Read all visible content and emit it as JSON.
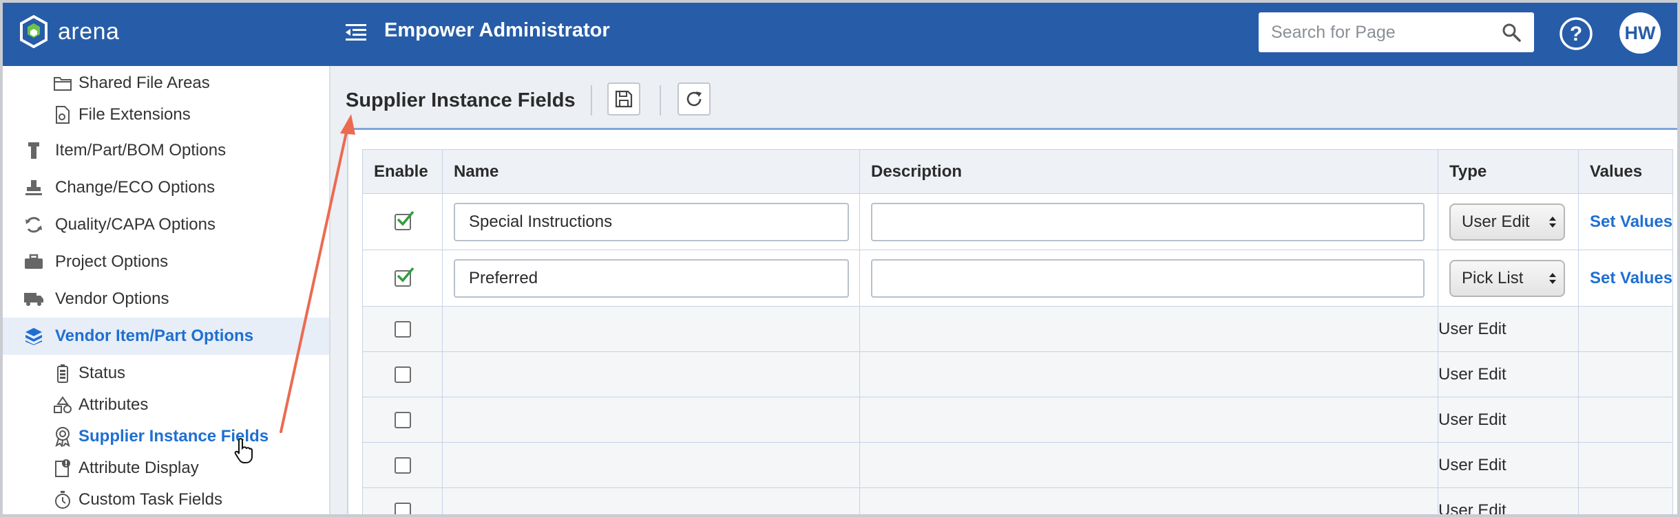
{
  "header": {
    "logo_text": "arena",
    "logo_mark": "®",
    "app_title": "Empower Administrator",
    "search_placeholder": "Search for Page",
    "avatar_initials": "HW",
    "brand_color": "#275da8"
  },
  "sidebar": {
    "items": [
      {
        "label": "Shared File Areas",
        "icon": "folder-icon",
        "level": "sub"
      },
      {
        "label": "File Extensions",
        "icon": "file-gear-icon",
        "level": "sub"
      },
      {
        "label": "Item/Part/BOM Options",
        "icon": "part-icon",
        "level": "top"
      },
      {
        "label": "Change/ECO Options",
        "icon": "stamp-icon",
        "level": "top"
      },
      {
        "label": "Quality/CAPA Options",
        "icon": "sync-icon",
        "level": "top"
      },
      {
        "label": "Project Options",
        "icon": "briefcase-icon",
        "level": "top"
      },
      {
        "label": "Vendor Options",
        "icon": "truck-icon",
        "level": "top"
      },
      {
        "label": "Vendor Item/Part Options",
        "icon": "boxes-icon",
        "level": "top",
        "active": true
      },
      {
        "label": "Status",
        "icon": "battery-icon",
        "level": "sub"
      },
      {
        "label": "Attributes",
        "icon": "shapes-icon",
        "level": "sub"
      },
      {
        "label": "Supplier Instance Fields",
        "icon": "ribbon-icon",
        "level": "sub",
        "selected": true
      },
      {
        "label": "Attribute Display",
        "icon": "doc-alert-icon",
        "level": "sub"
      },
      {
        "label": "Custom Task Fields",
        "icon": "stopwatch-icon",
        "level": "sub"
      }
    ]
  },
  "main": {
    "title": "Supplier Instance Fields",
    "columns": [
      "Enable",
      "Name",
      "Description",
      "Type",
      "Values"
    ],
    "rows": [
      {
        "enabled": true,
        "name": "Special Instructions",
        "description": "",
        "type": "User Edit",
        "type_select": true,
        "values": "Set Values"
      },
      {
        "enabled": true,
        "name": "Preferred",
        "description": "",
        "type": "Pick List",
        "type_select": true,
        "values": "Set Values"
      },
      {
        "enabled": false,
        "name": "",
        "description": "",
        "type": "User Edit",
        "type_select": false,
        "values": ""
      },
      {
        "enabled": false,
        "name": "",
        "description": "",
        "type": "User Edit",
        "type_select": false,
        "values": ""
      },
      {
        "enabled": false,
        "name": "",
        "description": "",
        "type": "User Edit",
        "type_select": false,
        "values": ""
      },
      {
        "enabled": false,
        "name": "",
        "description": "",
        "type": "User Edit",
        "type_select": false,
        "values": ""
      },
      {
        "enabled": false,
        "name": "",
        "description": "",
        "type": "User Edit",
        "type_select": false,
        "values": ""
      }
    ]
  }
}
